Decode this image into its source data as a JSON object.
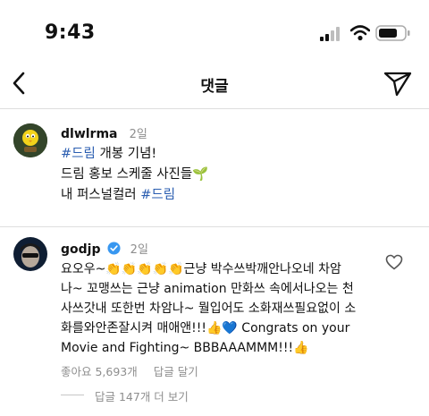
{
  "status_bar": {
    "time": "9:43"
  },
  "header": {
    "title": "댓글"
  },
  "caption": {
    "username": "dlwlrma",
    "age": "2일",
    "line1_tag": "#드림",
    "line1_text": " 개봉 기념!",
    "line2_text": "드림 홍보 스케줄 사진들",
    "line2_emoji": "🌱",
    "line3_text": "내 퍼스널컬러 ",
    "line3_tag": "#드림"
  },
  "comment": {
    "username": "godjp",
    "age": "2일",
    "line1_a": "요오우~",
    "line1_emoji": "👏👏👏👏👏",
    "line1_b": "근냥 박수쓰박깨안나오네 차암",
    "line2": "나~ 꼬맹쓰는 근냥 animation 만화쓰 속에서나오는 천",
    "line3": "사쓰갓내 또한번 차암나~ 뭘입어도 소화재쓰필요없이 소",
    "line4_a": "화를와안존잘시켜 매애앤!!!",
    "line4_emoji": "👍💙",
    "line4_b": " Congrats on your",
    "line5_a": "Movie and Fighting~ BBBAAAMMM!!!",
    "line5_emoji": "👍",
    "likes": "좋아요 5,693개",
    "reply_label": "답글 달기",
    "view_replies": "답글 147개 더 보기"
  },
  "colors": {
    "tag": "#2a5db0",
    "verified": "#3897f0",
    "meta": "#8e8e8e"
  },
  "icons": [
    "back-arrow-icon",
    "send-icon",
    "verified-icon",
    "heart-icon",
    "signal-icon",
    "wifi-icon",
    "battery-icon"
  ]
}
